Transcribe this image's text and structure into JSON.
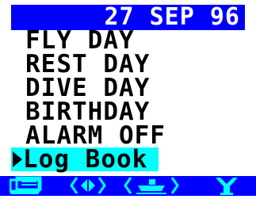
{
  "header": {
    "date": "27 SEP 96"
  },
  "menu": {
    "items": [
      {
        "label": "FLY DAY"
      },
      {
        "label": "REST DAY"
      },
      {
        "label": "DIVE DAY"
      },
      {
        "label": "BIRTHDAY"
      },
      {
        "label": "ALARM OFF"
      },
      {
        "label": "Log Book"
      }
    ],
    "selected_index": 5
  },
  "softkeys": [
    {
      "icon": "logbook-icon"
    },
    {
      "icon": "left-right-arrows-icon"
    },
    {
      "icon": "boat-icon"
    },
    {
      "icon": "diver-icon"
    }
  ],
  "colors": {
    "header_bg": "#0000ff",
    "header_text": "#ffffff",
    "selection_bg": "#00ffff",
    "softkey_bar": "#0000ff",
    "softkey_icon": "#00ffff"
  }
}
